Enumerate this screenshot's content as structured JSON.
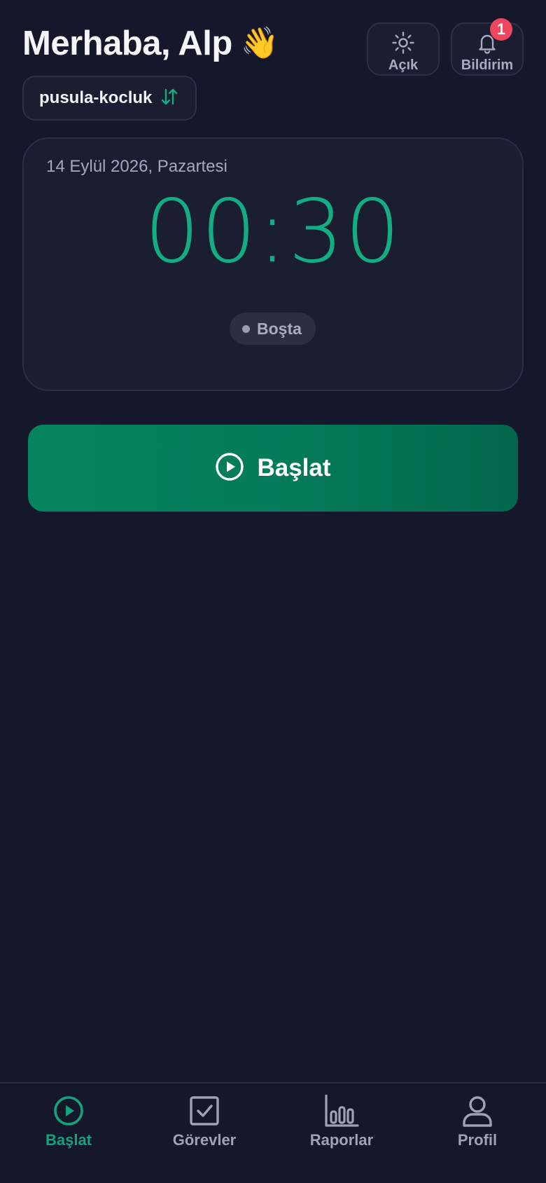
{
  "header": {
    "greeting": "Merhaba, Alp",
    "greeting_emoji": "👋",
    "theme_button": {
      "label": "Açık",
      "icon": "sun-icon"
    },
    "notification_button": {
      "label": "Bildirim",
      "icon": "bell-icon",
      "badge_count": "1"
    }
  },
  "workspace": {
    "name": "pusula-kocluk",
    "icon": "swap-vertical-icon"
  },
  "timer_card": {
    "date": "14 Eylül 2026, Pazartesi",
    "time": "00:30",
    "status": "Boşta"
  },
  "start_button": {
    "label": "Başlat",
    "icon": "play-circle-icon"
  },
  "bottom_nav": {
    "items": [
      {
        "label": "Başlat",
        "icon": "play-circle-icon",
        "active": true
      },
      {
        "label": "Görevler",
        "icon": "checkbox-icon",
        "active": false
      },
      {
        "label": "Raporlar",
        "icon": "bar-chart-icon",
        "active": false
      },
      {
        "label": "Profil",
        "icon": "user-icon",
        "active": false
      }
    ]
  },
  "colors": {
    "background": "#15172a",
    "accent": "#12ad85",
    "start_button": "#05845f",
    "badge": "#f0455f",
    "muted_text": "#a4a8bc"
  }
}
